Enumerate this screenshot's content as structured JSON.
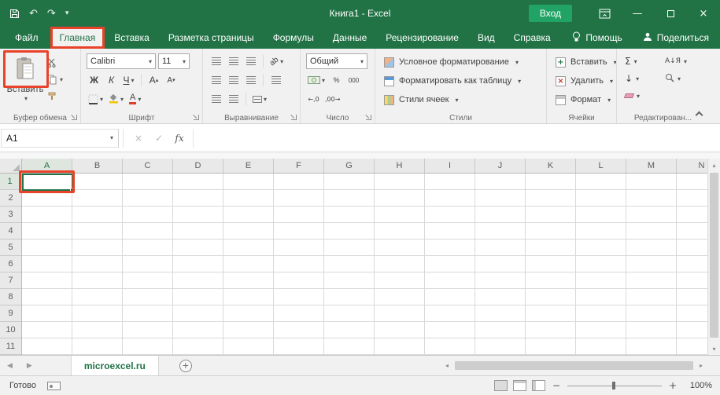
{
  "glyphs": {
    "chevron_down": "▾",
    "minimize": "—",
    "close": "×",
    "undo": "↶",
    "redo": "↷",
    "cancel": "×",
    "check": "✓",
    "fx": "fx",
    "sigma": "Σ",
    "percent": "%",
    "thousands": "000",
    "dec_increase": "←,0",
    "dec_decrease": ",00→",
    "fill_down": "↓",
    "sort": "А↓Я",
    "tri_up": "▴",
    "tri_down": "▾",
    "tri_left": "◂",
    "tri_right": "▸",
    "nav_left": "◀",
    "nav_right": "▶",
    "plus": "+",
    "minus": "−"
  },
  "titlebar": {
    "title": "Книга1 - Excel",
    "signin": "Вход"
  },
  "tabs": {
    "file": "Файл",
    "items": [
      "Главная",
      "Вставка",
      "Разметка страницы",
      "Формулы",
      "Данные",
      "Рецензирование",
      "Вид",
      "Справка"
    ],
    "help": "Помощь",
    "share": "Поделиться"
  },
  "ribbon": {
    "clipboard": {
      "label": "Буфер обмена",
      "paste": "Вставить"
    },
    "font": {
      "label": "Шрифт",
      "family": "Calibri",
      "size": "11",
      "bold": "Ж",
      "italic": "К",
      "underline": "Ч",
      "letter": "А"
    },
    "alignment": {
      "label": "Выравнивание",
      "orientation": "ab"
    },
    "number": {
      "label": "Число",
      "format": "Общий"
    },
    "styles": {
      "label": "Стили",
      "conditional": "Условное форматирование",
      "format_table": "Форматировать как таблицу",
      "cell_styles": "Стили ячеек"
    },
    "cells": {
      "label": "Ячейки",
      "insert": "Вставить",
      "delete": "Удалить",
      "format": "Формат"
    },
    "editing": {
      "label": "Редактирован..."
    }
  },
  "formula_bar": {
    "name_box": "A1"
  },
  "grid": {
    "columns": [
      "A",
      "B",
      "C",
      "D",
      "E",
      "F",
      "G",
      "H",
      "I",
      "J",
      "K",
      "L",
      "M",
      "N"
    ],
    "rows": [
      "1",
      "2",
      "3",
      "4",
      "5",
      "6",
      "7",
      "8",
      "9",
      "10",
      "11"
    ],
    "selected_cell": "A1"
  },
  "sheet_bar": {
    "sheet_name": "microexcel.ru"
  },
  "status_bar": {
    "ready": "Готово",
    "zoom": "100%"
  },
  "colors": {
    "excel_green": "#217346",
    "signin_green": "#21a366",
    "highlight_red": "#e8432a",
    "selection_green": "#217346"
  }
}
